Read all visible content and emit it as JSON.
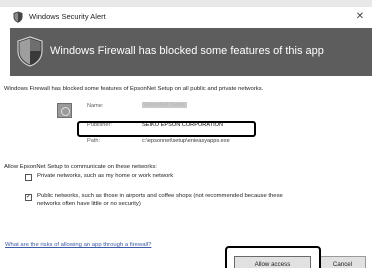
{
  "window": {
    "title": "Windows Security Alert",
    "close_glyph": "✕"
  },
  "banner": {
    "icon": "shield-icon",
    "heading": "Windows Firewall has blocked some features of this app"
  },
  "intro_text": "Windows Firewall has blocked some features of EpsonNet Setup on all public and private networks.",
  "app_info": {
    "icon": "app-icon",
    "name_label": "Name:",
    "name_value": "EpsonNet Setup",
    "publisher_label": "Publisher:",
    "publisher_value": "SEIKO EPSON CORPORATION",
    "path_label": "Path:",
    "path_value": "c:\\epsonnet\\setup\\enieasyapps.exe"
  },
  "allow_prompt": "Allow EpsonNet Setup to communicate on these networks:",
  "networks": {
    "private": {
      "checked": false,
      "label": "Private networks, such as my home or work network"
    },
    "public": {
      "checked": true,
      "check_glyph": "✓",
      "label": "Public networks, such as those in airports and coffee shops (not recommended because these networks often have little or no security)"
    }
  },
  "risk_link": "What are the risks of allowing an app through a firewall?",
  "buttons": {
    "allow": "Allow access",
    "cancel": "Cancel"
  },
  "colors": {
    "banner_bg": "#5d5d5d",
    "link": "#3d5aa6",
    "highlight": "#000000"
  }
}
